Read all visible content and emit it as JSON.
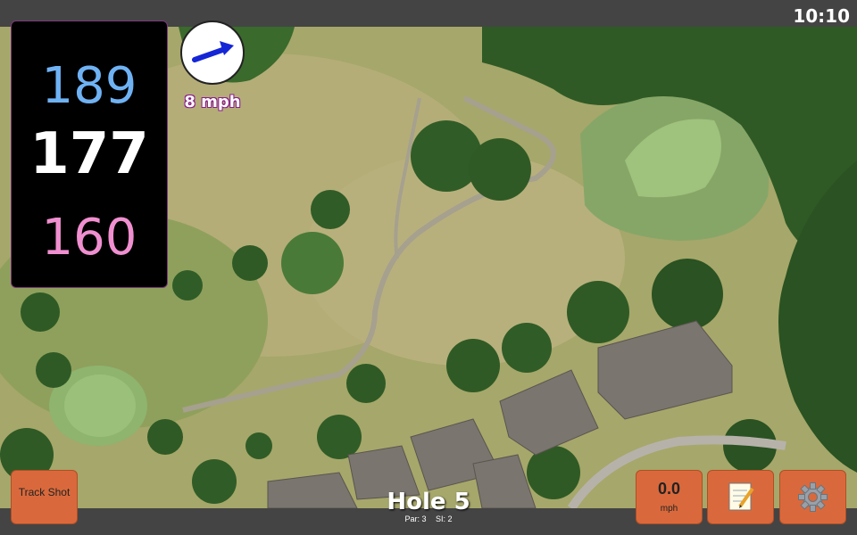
{
  "status": {
    "time": "10:10"
  },
  "distances": {
    "back": "189",
    "middle": "177",
    "front": "160"
  },
  "wind": {
    "speed": "8 mph",
    "icon": "wind-direction-arrow-icon"
  },
  "buttons": {
    "track_shot": "Track Shot",
    "speed_value": "0.0",
    "speed_unit": "mph",
    "notes_icon": "notepad-icon",
    "settings_icon": "gear-icon"
  },
  "hole": {
    "title": "Hole 5",
    "par": "Par: 3",
    "si": "SI: 2"
  },
  "colors": {
    "back": "#6fb2f4",
    "middle": "#ffffff",
    "front": "#f08fd0",
    "button": "#d9693c"
  }
}
